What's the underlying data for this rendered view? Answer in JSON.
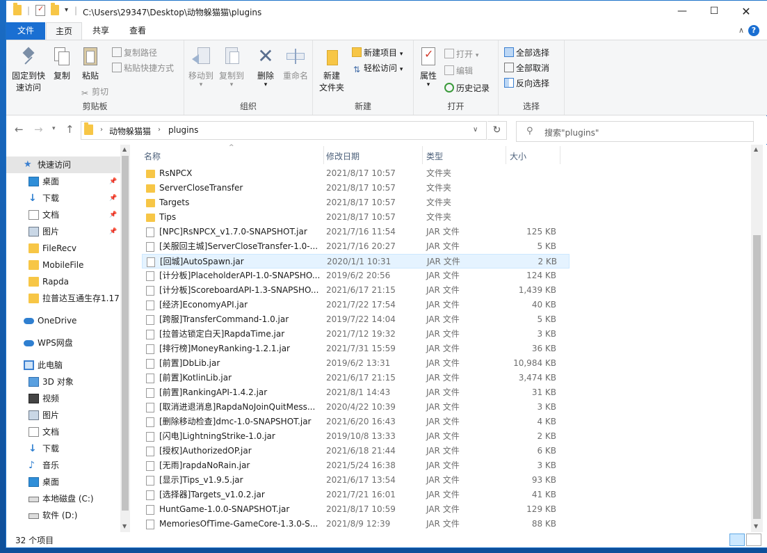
{
  "window": {
    "title_path": "C:\\Users\\29347\\Desktop\\动物躲猫猫\\plugins",
    "quick_access_dropdown": "▾"
  },
  "ribbon_tabs": [
    "文件",
    "主页",
    "共享",
    "查看"
  ],
  "ribbon": {
    "clipboard": {
      "pin": "固定到快\n速访问",
      "pin_l1": "固定到快",
      "pin_l2": "速访问",
      "copy": "复制",
      "paste": "粘贴",
      "copy_path": "复制路径",
      "paste_shortcut": "粘贴快捷方式",
      "cut": "剪切",
      "label": "剪贴板"
    },
    "organize": {
      "move_to": "移动到",
      "copy_to": "复制到",
      "delete": "删除",
      "rename": "重命名",
      "label": "组织"
    },
    "new": {
      "new_folder_l1": "新建",
      "new_folder_l2": "文件夹",
      "new_item": "新建项目",
      "easy_access": "轻松访问",
      "label": "新建"
    },
    "open": {
      "properties": "属性",
      "open": "打开",
      "edit": "编辑",
      "history": "历史记录",
      "label": "打开"
    },
    "select": {
      "select_all": "全部选择",
      "select_none": "全部取消",
      "invert": "反向选择",
      "label": "选择"
    }
  },
  "address": {
    "crumbs": [
      "动物躲猫猫",
      "plugins"
    ],
    "search_placeholder": "搜索\"plugins\""
  },
  "nav": [
    {
      "label": "快速访问",
      "icon": "star-icon",
      "sel": true
    },
    {
      "label": "桌面",
      "icon": "desktop-icon",
      "pin": true
    },
    {
      "label": "下载",
      "icon": "download-icon",
      "pin": true
    },
    {
      "label": "文档",
      "icon": "document-icon",
      "pin": true
    },
    {
      "label": "图片",
      "icon": "picture-icon",
      "pin": true
    },
    {
      "label": "FileRecv",
      "icon": "folder-icon"
    },
    {
      "label": "MobileFile",
      "icon": "folder-icon"
    },
    {
      "label": "Rapda",
      "icon": "folder-icon"
    },
    {
      "label": "拉普达互通生存1.17",
      "icon": "folder-icon"
    },
    {
      "label": "OneDrive",
      "icon": "cloud-icon"
    },
    {
      "label": "WPS网盘",
      "icon": "cloud-icon"
    },
    {
      "label": "此电脑",
      "icon": "computer-icon"
    },
    {
      "label": "3D 对象",
      "icon": "cube-icon"
    },
    {
      "label": "视频",
      "icon": "video-icon"
    },
    {
      "label": "图片",
      "icon": "picture-icon"
    },
    {
      "label": "文档",
      "icon": "document-icon"
    },
    {
      "label": "下载",
      "icon": "download-icon"
    },
    {
      "label": "音乐",
      "icon": "music-icon"
    },
    {
      "label": "桌面",
      "icon": "desktop-icon"
    },
    {
      "label": "本地磁盘 (C:)",
      "icon": "drive-icon"
    },
    {
      "label": "软件 (D:)",
      "icon": "drive-icon"
    }
  ],
  "columns": [
    "名称",
    "修改日期",
    "类型",
    "大小"
  ],
  "files": [
    {
      "name": "RsNPCX",
      "date": "2021/8/17 10:57",
      "type": "文件夹",
      "size": "",
      "kind": "folder"
    },
    {
      "name": "ServerCloseTransfer",
      "date": "2021/8/17 10:57",
      "type": "文件夹",
      "size": "",
      "kind": "folder"
    },
    {
      "name": "Targets",
      "date": "2021/8/17 10:57",
      "type": "文件夹",
      "size": "",
      "kind": "folder"
    },
    {
      "name": "Tips",
      "date": "2021/8/17 10:57",
      "type": "文件夹",
      "size": "",
      "kind": "folder"
    },
    {
      "name": "[NPC]RsNPCX_v1.7.0-SNAPSHOT.jar",
      "date": "2021/7/16 11:54",
      "type": "JAR 文件",
      "size": "125 KB",
      "kind": "jar"
    },
    {
      "name": "[关服回主城]ServerCloseTransfer-1.0-...",
      "date": "2021/7/16 20:27",
      "type": "JAR 文件",
      "size": "5 KB",
      "kind": "jar"
    },
    {
      "name": "[回城]AutoSpawn.jar",
      "date": "2020/1/1 10:31",
      "type": "JAR 文件",
      "size": "2 KB",
      "kind": "jar",
      "hl": true
    },
    {
      "name": "[计分板]PlaceholderAPI-1.0-SNAPSHO...",
      "date": "2019/6/2 20:56",
      "type": "JAR 文件",
      "size": "124 KB",
      "kind": "jar"
    },
    {
      "name": "[计分板]ScoreboardAPI-1.3-SNAPSHO...",
      "date": "2021/6/17 21:15",
      "type": "JAR 文件",
      "size": "1,439 KB",
      "kind": "jar"
    },
    {
      "name": "[经济]EconomyAPI.jar",
      "date": "2021/7/22 17:54",
      "type": "JAR 文件",
      "size": "40 KB",
      "kind": "jar"
    },
    {
      "name": "[跨服]TransferCommand-1.0.jar",
      "date": "2019/7/22 14:04",
      "type": "JAR 文件",
      "size": "5 KB",
      "kind": "jar"
    },
    {
      "name": "[拉普达锁定白天]RapdaTime.jar",
      "date": "2021/7/12 19:32",
      "type": "JAR 文件",
      "size": "3 KB",
      "kind": "jar"
    },
    {
      "name": "[排行榜]MoneyRanking-1.2.1.jar",
      "date": "2021/7/31 15:59",
      "type": "JAR 文件",
      "size": "36 KB",
      "kind": "jar"
    },
    {
      "name": "[前置]DbLib.jar",
      "date": "2019/6/2 13:31",
      "type": "JAR 文件",
      "size": "10,984 KB",
      "kind": "jar"
    },
    {
      "name": "[前置]KotlinLib.jar",
      "date": "2021/6/17 21:15",
      "type": "JAR 文件",
      "size": "3,474 KB",
      "kind": "jar"
    },
    {
      "name": "[前置]RankingAPI-1.4.2.jar",
      "date": "2021/8/1 14:43",
      "type": "JAR 文件",
      "size": "31 KB",
      "kind": "jar"
    },
    {
      "name": "[取消进退消息]RapdaNoJoinQuitMess...",
      "date": "2020/4/22 10:39",
      "type": "JAR 文件",
      "size": "3 KB",
      "kind": "jar"
    },
    {
      "name": "[删除移动检查]dmc-1.0-SNAPSHOT.jar",
      "date": "2021/6/20 16:43",
      "type": "JAR 文件",
      "size": "4 KB",
      "kind": "jar"
    },
    {
      "name": "[闪电]LightningStrike-1.0.jar",
      "date": "2019/10/8 13:33",
      "type": "JAR 文件",
      "size": "2 KB",
      "kind": "jar"
    },
    {
      "name": "[授权]AuthorizedOP.jar",
      "date": "2021/6/18 21:44",
      "type": "JAR 文件",
      "size": "6 KB",
      "kind": "jar"
    },
    {
      "name": "[无雨]rapdaNoRain.jar",
      "date": "2021/5/24 16:38",
      "type": "JAR 文件",
      "size": "3 KB",
      "kind": "jar"
    },
    {
      "name": "[显示]Tips_v1.9.5.jar",
      "date": "2021/6/17 13:54",
      "type": "JAR 文件",
      "size": "93 KB",
      "kind": "jar"
    },
    {
      "name": "[选择器]Targets_v1.0.2.jar",
      "date": "2021/7/21 16:01",
      "type": "JAR 文件",
      "size": "41 KB",
      "kind": "jar"
    },
    {
      "name": "HuntGame-1.0.0-SNAPSHOT.jar",
      "date": "2021/8/17 10:59",
      "type": "JAR 文件",
      "size": "129 KB",
      "kind": "jar"
    },
    {
      "name": "MemoriesOfTime-GameCore-1.3.0-S...",
      "date": "2021/8/9 12:39",
      "type": "JAR 文件",
      "size": "88 KB",
      "kind": "jar"
    }
  ],
  "status": {
    "count": "32 个项目"
  },
  "colors": {
    "accent": "#1a6fd2",
    "folder": "#f7c646",
    "hover": "#e5f3ff"
  }
}
